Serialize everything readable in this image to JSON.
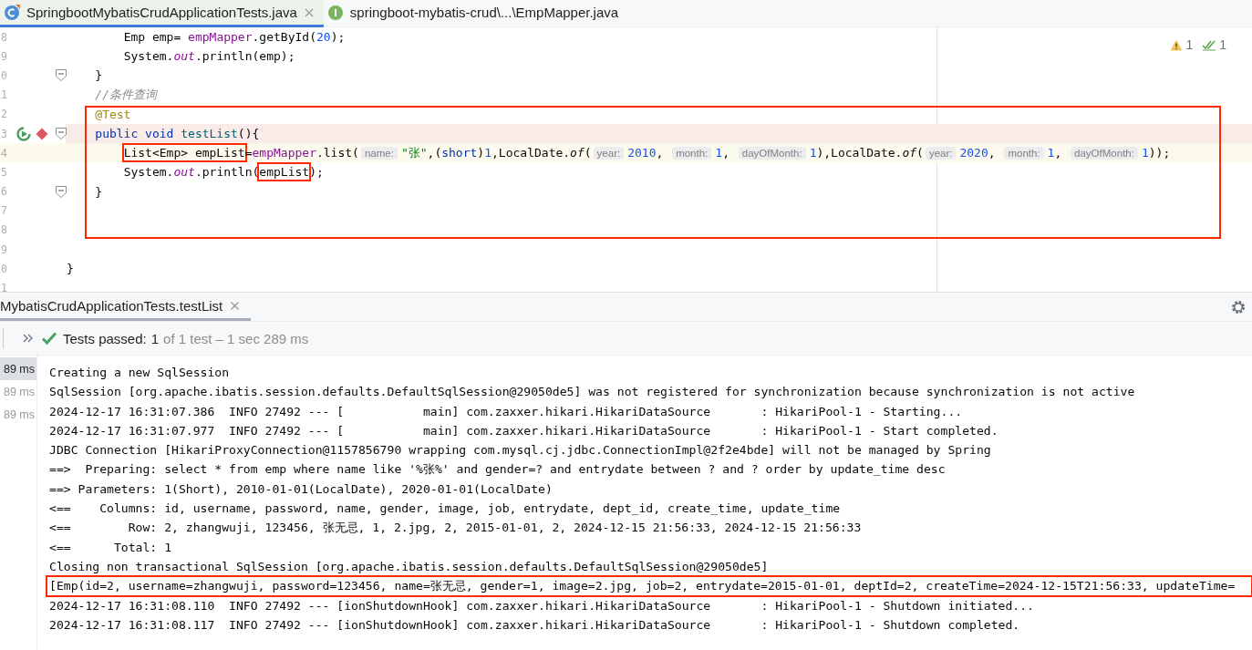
{
  "editor_tabs": [
    {
      "label": "SpringbootMybatisCrudApplicationTests.java",
      "kind": "class",
      "selected": true
    },
    {
      "label": "springboot-mybatis-crud\\...\\EmpMapper.java",
      "kind": "interface",
      "selected": false
    }
  ],
  "editor": {
    "inspections": [
      {
        "kind": "warning",
        "count": "1"
      },
      {
        "kind": "check",
        "count": "1"
      }
    ],
    "blocks": [
      {
        "framed": false,
        "lines": [
          {
            "number": "8",
            "fold": false,
            "breakpoint": false,
            "current": false,
            "tokens": [
              {
                "t": "        Emp emp= ",
                "kind": "plain"
              },
              {
                "t": "empMapper",
                "kind": "field"
              },
              {
                "t": ".getById(",
                "kind": "plain"
              },
              {
                "t": "20",
                "kind": "number"
              },
              {
                "t": ");",
                "kind": "plain"
              }
            ]
          },
          {
            "number": "9",
            "fold": false,
            "breakpoint": false,
            "current": false,
            "tokens": [
              {
                "t": "        System.",
                "kind": "plain"
              },
              {
                "t": "out",
                "kind": "static"
              },
              {
                "t": ".println(emp);",
                "kind": "plain"
              }
            ]
          },
          {
            "number": "0",
            "fold": true,
            "breakpoint": false,
            "current": false,
            "tokens": [
              {
                "t": "    }",
                "kind": "plain"
              }
            ]
          },
          {
            "number": "1",
            "fold": false,
            "breakpoint": false,
            "current": false,
            "tokens": [
              {
                "t": "    //条件查询",
                "kind": "comment"
              }
            ]
          }
        ]
      },
      {
        "framed": true,
        "lines": [
          {
            "number": "2",
            "fold": false,
            "breakpoint": false,
            "current": false,
            "tokens": [
              {
                "t": "    @Test",
                "kind": "annotation"
              }
            ]
          },
          {
            "number": "3",
            "fold": true,
            "breakpoint": true,
            "current": false,
            "tokens": [
              {
                "t": "    public void ",
                "kind": "keyword"
              },
              {
                "t": "testList",
                "kind": "method"
              },
              {
                "t": "(){",
                "kind": "plain"
              }
            ]
          },
          {
            "number": "4",
            "fold": false,
            "breakpoint": false,
            "current": true,
            "tokens": [
              {
                "t": "        List<Emp> empList",
                "kind": "plain",
                "boxed": true
              },
              {
                "t": "=",
                "kind": "plain"
              },
              {
                "t": "empMapper",
                "kind": "field"
              },
              {
                "t": ".list(",
                "kind": "plain"
              },
              {
                "t": "name:",
                "kind": "hint"
              },
              {
                "t": "\"张\"",
                "kind": "string"
              },
              {
                "t": ",(",
                "kind": "plain"
              },
              {
                "t": "short",
                "kind": "keyword"
              },
              {
                "t": ")",
                "kind": "plain"
              },
              {
                "t": "1",
                "kind": "number"
              },
              {
                "t": ",LocalDate.",
                "kind": "plain"
              },
              {
                "t": "of",
                "kind": "italic"
              },
              {
                "t": "(",
                "kind": "plain"
              },
              {
                "t": "year:",
                "kind": "hint"
              },
              {
                "t": "2010",
                "kind": "number"
              },
              {
                "t": ", ",
                "kind": "plain"
              },
              {
                "t": "month:",
                "kind": "hint"
              },
              {
                "t": "1",
                "kind": "number"
              },
              {
                "t": ", ",
                "kind": "plain"
              },
              {
                "t": "dayOfMonth:",
                "kind": "hint"
              },
              {
                "t": "1",
                "kind": "number"
              },
              {
                "t": "),LocalDate.",
                "kind": "plain"
              },
              {
                "t": "of",
                "kind": "italic"
              },
              {
                "t": "(",
                "kind": "plain"
              },
              {
                "t": "year:",
                "kind": "hint"
              },
              {
                "t": "2020",
                "kind": "number"
              },
              {
                "t": ", ",
                "kind": "plain"
              },
              {
                "t": "month:",
                "kind": "hint"
              },
              {
                "t": "1",
                "kind": "number"
              },
              {
                "t": ", ",
                "kind": "plain"
              },
              {
                "t": "dayOfMonth:",
                "kind": "hint"
              },
              {
                "t": "1",
                "kind": "number"
              },
              {
                "t": "));",
                "kind": "plain"
              }
            ]
          },
          {
            "number": "5",
            "fold": false,
            "breakpoint": false,
            "current": false,
            "tokens": [
              {
                "t": "        System.",
                "kind": "plain"
              },
              {
                "t": "out",
                "kind": "static"
              },
              {
                "t": ".println(",
                "kind": "plain"
              },
              {
                "t": "empList",
                "kind": "plain",
                "boxed": true
              },
              {
                "t": ");",
                "kind": "plain"
              }
            ]
          },
          {
            "number": "6",
            "fold": true,
            "breakpoint": false,
            "current": false,
            "tokens": [
              {
                "t": "    }",
                "kind": "plain"
              }
            ]
          },
          {
            "number": "7",
            "fold": false,
            "breakpoint": false,
            "current": false
          },
          {
            "number": "8",
            "fold": false,
            "breakpoint": false,
            "current": false
          }
        ]
      },
      {
        "framed": false,
        "lines": [
          {
            "number": "9",
            "fold": false,
            "breakpoint": false,
            "current": false
          },
          {
            "number": "0",
            "fold": false,
            "breakpoint": false,
            "current": false,
            "tokens": [
              {
                "t": "}",
                "kind": "plain"
              }
            ]
          },
          {
            "number": "1",
            "fold": false,
            "breakpoint": false,
            "current": false
          }
        ]
      }
    ]
  },
  "run_panel": {
    "tab": {
      "label": "MybatisCrudApplicationTests.testList",
      "selected": true
    },
    "status": {
      "label": "Tests passed:",
      "count": "1",
      "detail": "of 1 test – 1 sec 289 ms"
    },
    "timings": [
      {
        "label": "89 ms",
        "selected": true
      },
      {
        "label": "89 ms",
        "selected": false
      },
      {
        "label": "89 ms",
        "selected": false
      }
    ],
    "console": [
      {
        "text": "Creating a new SqlSession",
        "boxed": false
      },
      {
        "text": "SqlSession [org.apache.ibatis.session.defaults.DefaultSqlSession@29050de5] was not registered for synchronization because synchronization is not active",
        "boxed": false
      },
      {
        "text": "2024-12-17 16:31:07.386  INFO 27492 --- [           main] com.zaxxer.hikari.HikariDataSource       : HikariPool-1 - Starting...",
        "boxed": false
      },
      {
        "text": "2024-12-17 16:31:07.977  INFO 27492 --- [           main] com.zaxxer.hikari.HikariDataSource       : HikariPool-1 - Start completed.",
        "boxed": false
      },
      {
        "text": "JDBC Connection [HikariProxyConnection@1157856790 wrapping com.mysql.cj.jdbc.ConnectionImpl@2f2e4bde] will not be managed by Spring",
        "boxed": false
      },
      {
        "text": "==>  Preparing: select * from emp where name like '%张%' and gender=? and entrydate between ? and ? order by update_time desc",
        "boxed": false
      },
      {
        "text": "==> Parameters: 1(Short), 2010-01-01(LocalDate), 2020-01-01(LocalDate)",
        "boxed": false
      },
      {
        "text": "<==    Columns: id, username, password, name, gender, image, job, entrydate, dept_id, create_time, update_time",
        "boxed": false
      },
      {
        "text": "<==        Row: 2, zhangwuji, 123456, 张无忌, 1, 2.jpg, 2, 2015-01-01, 2, 2024-12-15 21:56:33, 2024-12-15 21:56:33",
        "boxed": false
      },
      {
        "text": "<==      Total: 1",
        "boxed": false
      },
      {
        "text": "Closing non transactional SqlSession [org.apache.ibatis.session.defaults.DefaultSqlSession@29050de5]",
        "boxed": false
      },
      {
        "text": "[Emp(id=2, username=zhangwuji, password=123456, name=张无忌, gender=1, image=2.jpg, job=2, entrydate=2015-01-01, deptId=2, createTime=2024-12-15T21:56:33, updateTime=",
        "boxed": true
      },
      {
        "text": "2024-12-17 16:31:08.110  INFO 27492 --- [ionShutdownHook] com.zaxxer.hikari.HikariDataSource       : HikariPool-1 - Shutdown initiated...",
        "boxed": false
      },
      {
        "text": "2024-12-17 16:31:08.117  INFO 27492 --- [ionShutdownHook] com.zaxxer.hikari.HikariDataSource       : HikariPool-1 - Shutdown completed.",
        "boxed": false
      }
    ]
  }
}
